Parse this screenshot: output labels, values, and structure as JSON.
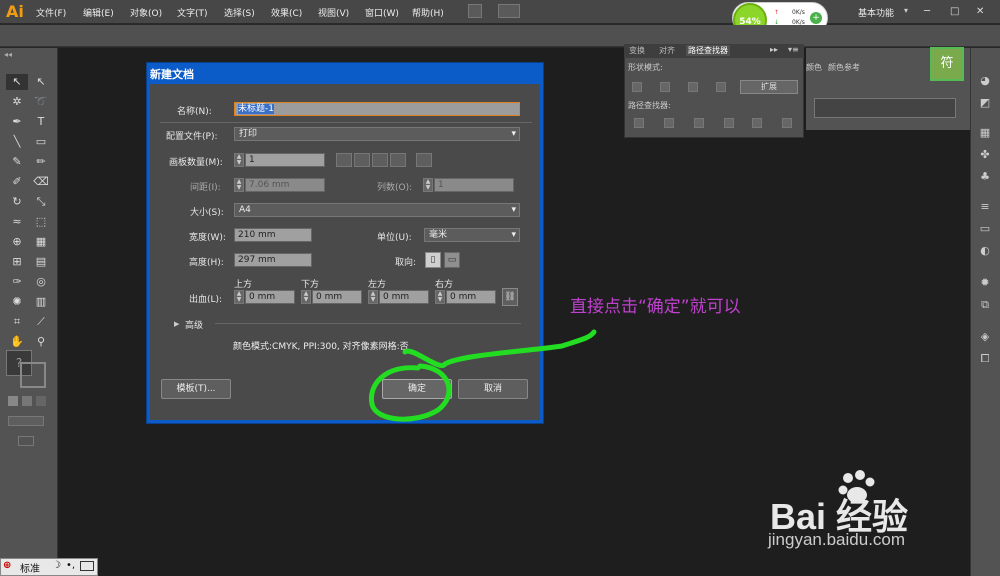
{
  "app": {
    "logo": "Ai",
    "workspace": "基本功能"
  },
  "menu": [
    "文件(F)",
    "编辑(E)",
    "对象(O)",
    "文字(T)",
    "选择(S)",
    "效果(C)",
    "视图(V)",
    "窗口(W)",
    "帮助(H)"
  ],
  "perf_widget": {
    "percent": "54%",
    "up": "0K/s",
    "down": "0K/s"
  },
  "pathfinder": {
    "tabs": [
      "变换",
      "对齐",
      "路径查找器"
    ],
    "shape_modes": "形状模式:",
    "pathfinders": "路径查找器:",
    "expand": "扩展"
  },
  "right_dock": {
    "tab1": "颜色",
    "tab2": "颜色参考"
  },
  "badge": "符",
  "dialog": {
    "title": "新建文档",
    "name_label": "名称(N):",
    "name_value": "未标题-1",
    "profile_label": "配置文件(P):",
    "profile_value": "打印",
    "artboards_label": "画板数量(M):",
    "artboards_value": "1",
    "spacing_label": "间距(I):",
    "spacing_value": "7.06 mm",
    "columns_label": "列数(O):",
    "columns_value": "1",
    "size_label": "大小(S):",
    "size_value": "A4",
    "width_label": "宽度(W):",
    "width_value": "210 mm",
    "units_label": "单位(U):",
    "units_value": "毫米",
    "height_label": "高度(H):",
    "height_value": "297 mm",
    "orientation_label": "取向:",
    "bleed_label": "出血(L):",
    "bleed_headers": [
      "上方",
      "下方",
      "左方",
      "右方"
    ],
    "bleed_values": [
      "0 mm",
      "0 mm",
      "0 mm",
      "0 mm"
    ],
    "advanced": "高级",
    "info": "颜色模式:CMYK, PPI:300, 对齐像素网格:否",
    "templates_btn": "模板(T)...",
    "ok_btn": "确定",
    "cancel_btn": "取消"
  },
  "annotation": "直接点击“确定”就可以",
  "watermark": {
    "brand": "Bai 经验",
    "url": "jingyan.baidu.com"
  },
  "statusbar": {
    "ime": "标准"
  },
  "colors": {
    "dialog_title_bg": "#0b5cc8",
    "highlight": "#22dd22",
    "annotation": "#c040d0"
  }
}
